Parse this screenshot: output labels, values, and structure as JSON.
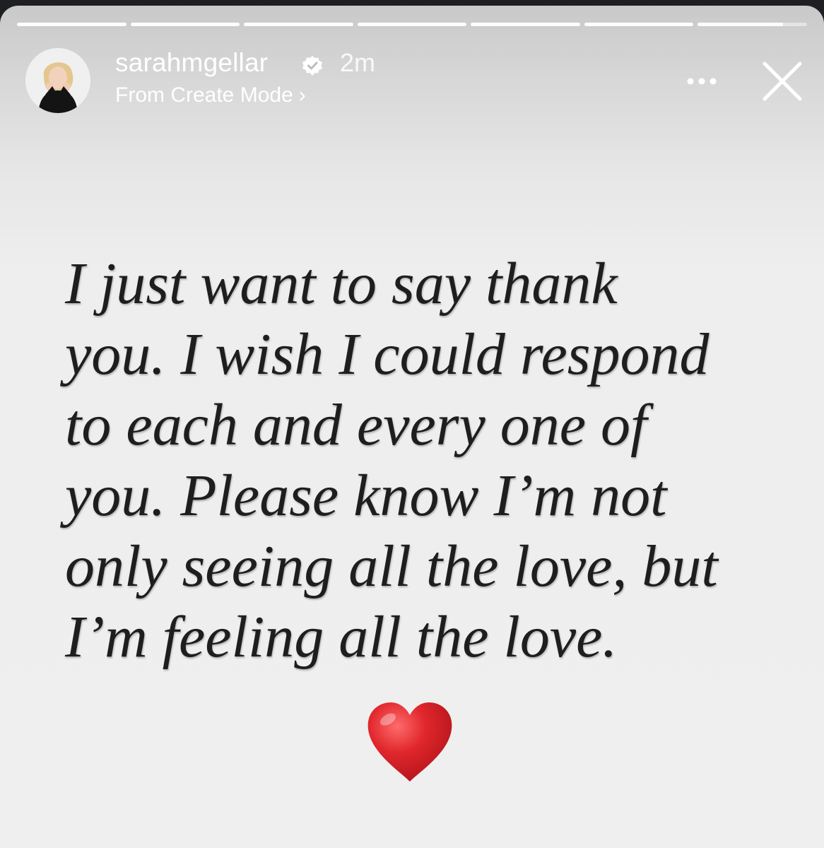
{
  "story": {
    "progress_segments": 7,
    "current_segment_progress": 0.78,
    "header": {
      "username": "sarahmgellar",
      "verified": true,
      "timestamp": "2m",
      "subtitle": "From Create Mode",
      "subtitle_chevron": "›"
    },
    "icons": {
      "avatar": "profile-photo",
      "verified": "verified-badge-icon",
      "more": "more-options-icon",
      "close": "close-icon",
      "heart": "red-heart-emoji"
    },
    "message_lines": [
      "I just want to say thank",
      "you. I wish I could respond",
      "to each and every one of",
      "you. Please know I’m not",
      "only seeing all the love, but",
      "I’m feeling all the love."
    ],
    "colors": {
      "heart": "#d8262b",
      "text": "#1e1e1e",
      "header_text": "#ffffff",
      "frame": "#1d1f22"
    }
  }
}
